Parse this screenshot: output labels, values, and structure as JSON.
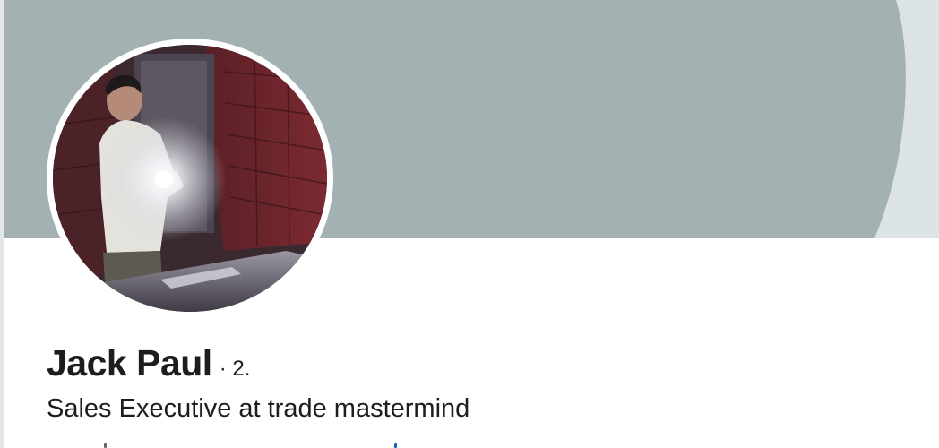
{
  "profile": {
    "name": "Jack Paul",
    "degree": "· 2.",
    "headline": "Sales Executive at trade mastermind"
  },
  "colors": {
    "banner": "#a3b1b3",
    "banner_edge": "#dbe3e5",
    "text": "#1d1d1d",
    "link": "#0a66c2"
  },
  "icons": {
    "avatar": "profile-photo"
  }
}
